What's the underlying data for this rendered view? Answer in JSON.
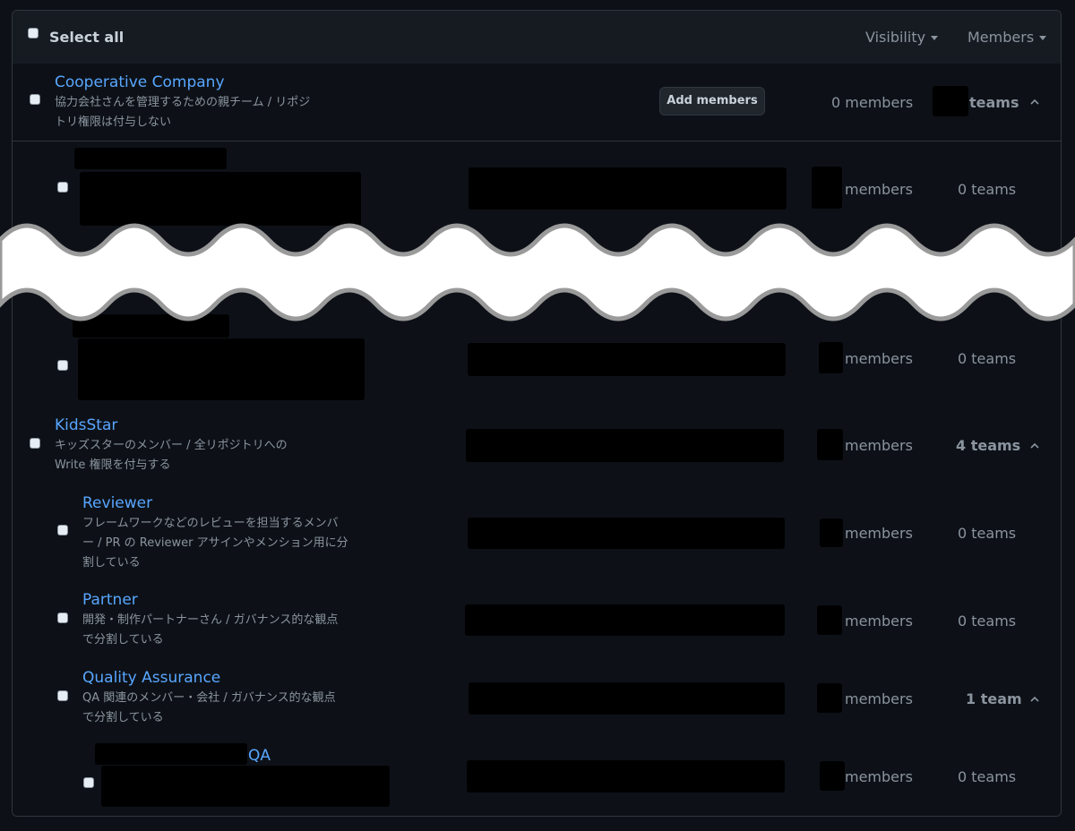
{
  "header": {
    "select_all": "Select all",
    "visibility": "Visibility",
    "members": "Members"
  },
  "teams": {
    "cooperative": {
      "name": "Cooperative Company",
      "desc1": "協力会社さんを管理するための親チーム / リポジ",
      "desc2": "トリ権限は付与しない",
      "add_members": "Add members",
      "members": "0 members",
      "teams": "teams"
    },
    "child1": {
      "members": "members",
      "teams": "0 teams"
    },
    "child2": {
      "members": "members",
      "teams": "0 teams"
    },
    "kidsstar": {
      "name": "KidsStar",
      "desc1": "キッズスターのメンバー / 全リポジトリへの",
      "desc2": "Write 権限を付与する",
      "members": "members",
      "teams": "4 teams"
    },
    "reviewer": {
      "name": "Reviewer",
      "desc1": "フレームワークなどのレビューを担当するメンバ",
      "desc2": "ー / PR の Reviewer アサインやメンション用に分",
      "desc3": "割している",
      "members": "members",
      "teams": "0 teams"
    },
    "partner": {
      "name": "Partner",
      "desc1": "開発・制作パートナーさん / ガバナンス的な観点",
      "desc2": "で分割している",
      "members": "members",
      "teams": "0 teams"
    },
    "qa": {
      "name": "Quality Assurance",
      "desc1": "QA 関連のメンバー・会社 / ガバナンス的な観点",
      "desc2": "で分割している",
      "members": "members",
      "teams": "1 team"
    },
    "qa_child": {
      "name": "QA",
      "members": "members",
      "teams": "0 teams"
    }
  },
  "colors": {
    "accent": "#58a6ff",
    "bg": "#0d1117",
    "border": "#30363d"
  }
}
